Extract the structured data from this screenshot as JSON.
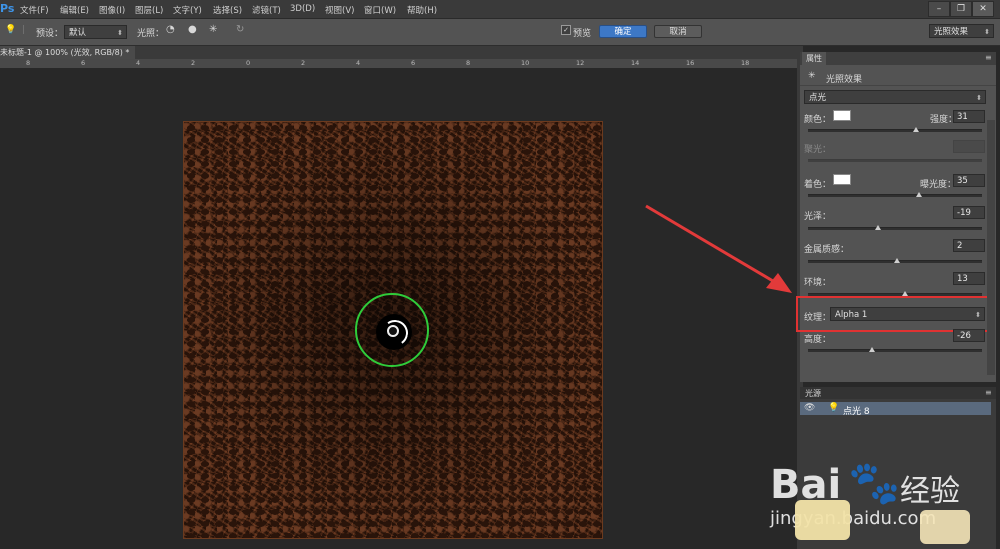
{
  "app": {
    "logo": "Ps",
    "menu": [
      "文件(F)",
      "编辑(E)",
      "图像(I)",
      "图层(L)",
      "文字(Y)",
      "选择(S)",
      "滤镜(T)",
      "3D(D)",
      "视图(V)",
      "窗口(W)",
      "帮助(H)"
    ]
  },
  "options_bar": {
    "preset_label": "预设：",
    "preset_value": "默认",
    "lights_label": "光照：",
    "preview_label": "预览",
    "ok_label": "确定",
    "cancel_label": "取消",
    "workspace_value": "光照效果"
  },
  "document": {
    "tab_title": "未标题-1 @ 100% (光效, RGB/8) *",
    "ruler_ticks": [
      "8",
      "6",
      "4",
      "2",
      "0",
      "2",
      "4",
      "6",
      "8",
      "10",
      "12",
      "14",
      "16",
      "18"
    ]
  },
  "properties": {
    "tab": "属性",
    "title": "光照效果",
    "light_type": "点光",
    "color_label": "颜色：",
    "intensity_label": "强度：",
    "intensity_value": "31",
    "hotspot_label": "聚光：",
    "colorize_label": "着色：",
    "exposure_label": "曝光度：",
    "exposure_value": "35",
    "gloss_label": "光泽：",
    "gloss_value": "-19",
    "metallic_label": "金属质感：",
    "metallic_value": "2",
    "ambience_label": "环境：",
    "ambience_value": "13",
    "texture_label": "纹理：",
    "texture_value": "Alpha 1",
    "height_label": "高度：",
    "height_value": "-26",
    "slider_levels": {
      "intensity": 0.62,
      "exposure": 0.64,
      "gloss": 0.4,
      "metallic": 0.51,
      "ambience": 0.56,
      "height": 0.37
    }
  },
  "lights_panel": {
    "tab": "光源",
    "light_name": "点光 8"
  },
  "watermark": {
    "brand": "Bai",
    "brand_cn": "经验",
    "url": "jingyan.baidu.com"
  }
}
